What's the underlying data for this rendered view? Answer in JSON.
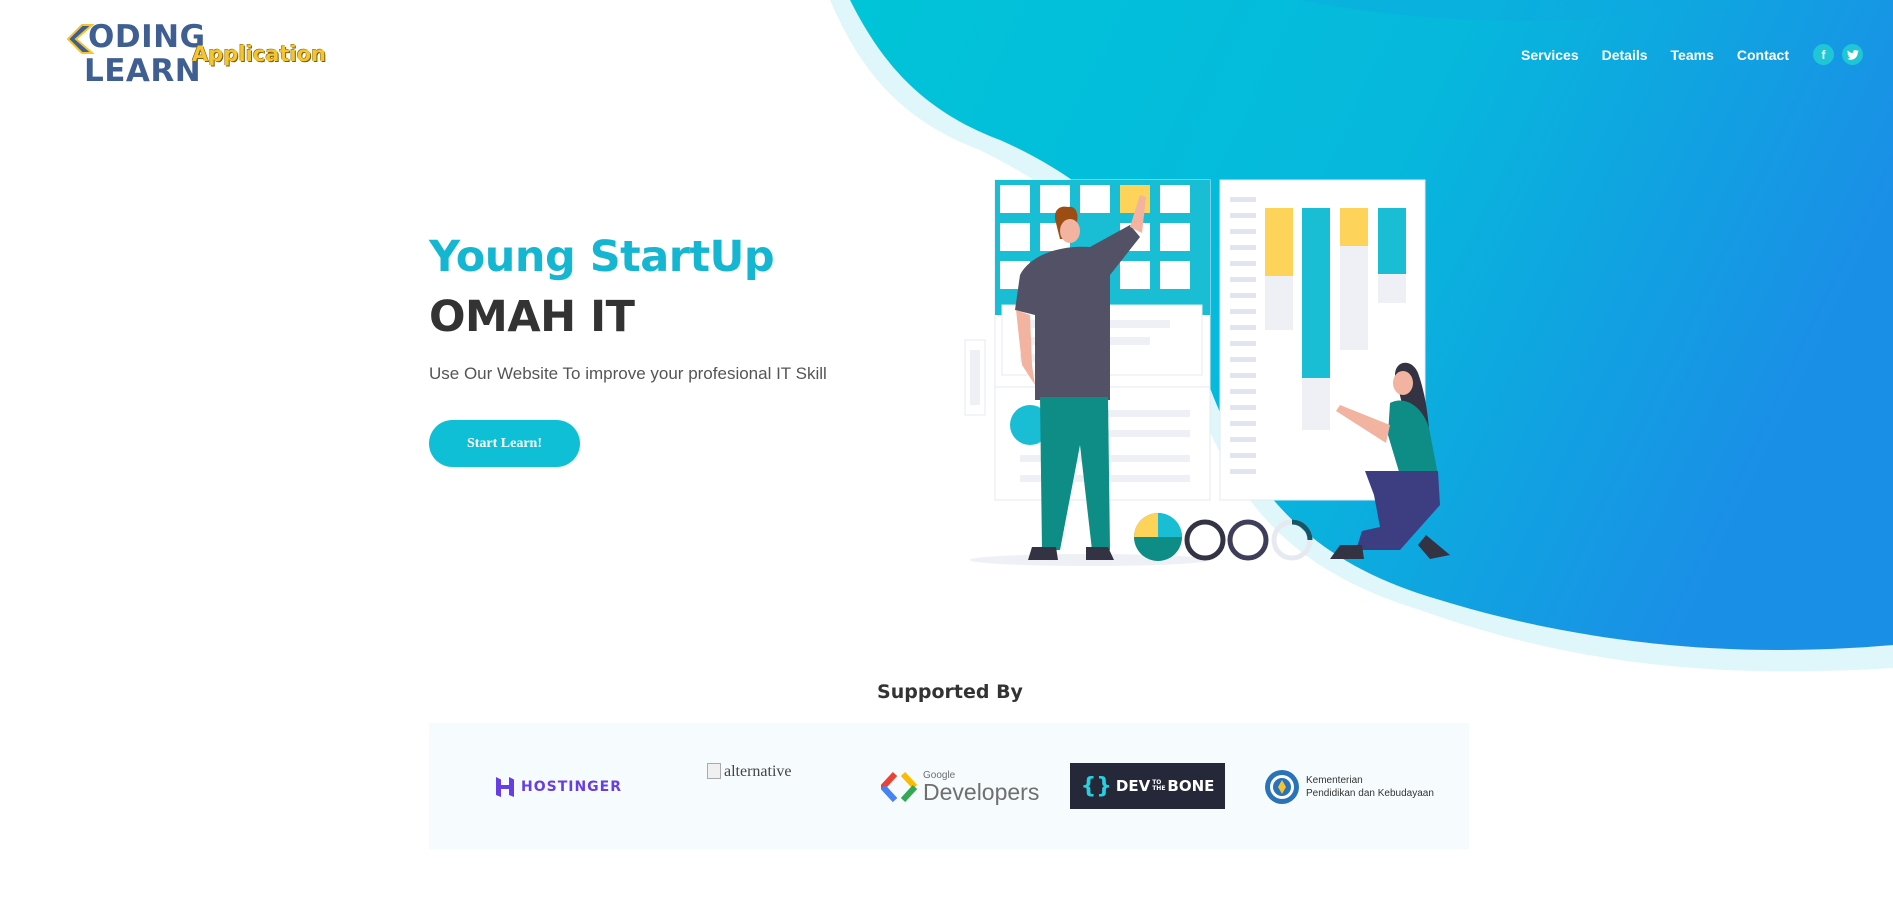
{
  "logo": {
    "line1": "ODING",
    "line2": "LEARN",
    "app": "Application"
  },
  "nav": {
    "items": [
      "Services",
      "Details",
      "Teams",
      "Contact"
    ],
    "social": [
      {
        "icon": "facebook-icon",
        "glyph": "f"
      },
      {
        "icon": "twitter-icon",
        "glyph": "t"
      }
    ]
  },
  "hero": {
    "title_line1": "Young StartUp",
    "title_line2": "OMAH IT",
    "description": "Use Our Website To improve your profesional IT Skill",
    "button_label": "Start Learn!"
  },
  "supported": {
    "title": "Supported By",
    "sponsors": {
      "hostinger": "HOSTINGER",
      "alternative": "alternative",
      "google_small": "Google",
      "google_dev": "Developers",
      "devbone_dev": "DEV",
      "devbone_to": "TO",
      "devbone_the": "THE",
      "devbone_bone": "BONE",
      "kemen_line1": "Kementerian",
      "kemen_line2": "Pendidikan dan Kebudayaan"
    }
  },
  "colors": {
    "accent": "#15b6d2",
    "blob_start": "#00c4d8",
    "blob_end": "#1a8fe6",
    "dark_text": "#333333"
  }
}
